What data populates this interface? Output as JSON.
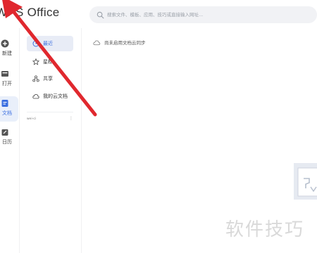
{
  "app": {
    "title": "WPS Office"
  },
  "search": {
    "placeholder": "搜索文件、模板、应用、技巧或直接输入网址..."
  },
  "rail": {
    "items": [
      {
        "label": "新建",
        "icon": "plus-circle-icon"
      },
      {
        "label": "打开",
        "icon": "open-folder-icon"
      },
      {
        "label": "文档",
        "icon": "document-icon",
        "active": true
      },
      {
        "label": "日历",
        "icon": "calendar-icon"
      }
    ]
  },
  "sidebar": {
    "items": [
      {
        "label": "最近",
        "icon": "clock-icon",
        "active": true
      },
      {
        "label": "星标",
        "icon": "star-icon"
      },
      {
        "label": "共享",
        "icon": "share-icon"
      },
      {
        "label": "我的云文档",
        "icon": "cloud-icon"
      }
    ],
    "section_label": "wei-ci",
    "section_more": "⋮"
  },
  "main": {
    "cloud_notice": "尚未启用文档云同步"
  },
  "watermark": "软件技巧",
  "colors": {
    "accent": "#3b6fe0",
    "annotation_arrow": "#e0282e",
    "search_bg": "#f1f2f5",
    "active_bg": "#e8ecf6"
  }
}
